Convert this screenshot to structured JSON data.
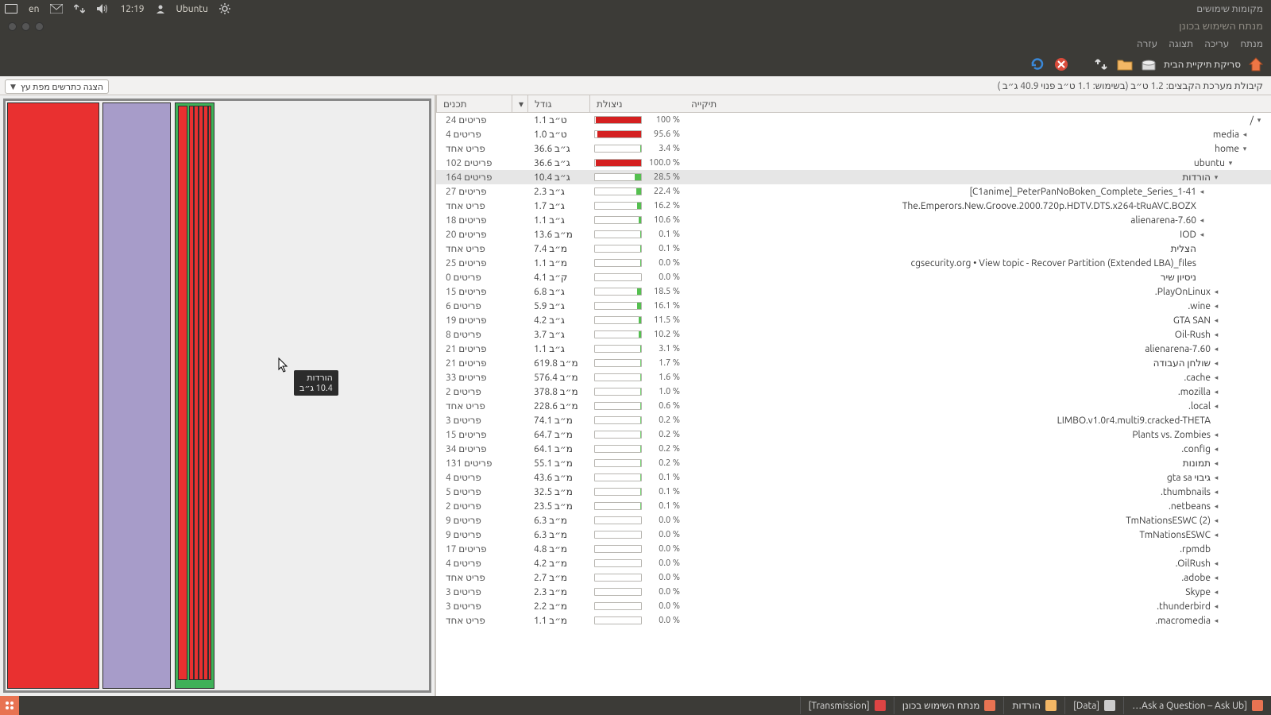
{
  "topbar": {
    "lang": "en",
    "time": "12:19",
    "user": "Ubuntu",
    "right_text": "מקומות שימושים"
  },
  "window": {
    "title": "מנתח השימוש בכונן"
  },
  "menubar": [
    "מנתח",
    "עריכה",
    "תצוגה",
    "עזרה"
  ],
  "toolbar": {
    "scan_home": "סריקת תיקיית הבית"
  },
  "usage": {
    "text": "קיבולת מערכת הקבצים: 1.2 ט״ב (בשימוש: 1.1 ט״ב פנוי 40.9 ג״ב )"
  },
  "viewbutton": "הצגה כתרשים מפת עץ",
  "headers": {
    "folder": "תיקייה",
    "util": "ניצולת",
    "size": "גודל",
    "contents": "תכנים"
  },
  "rows": [
    {
      "name": "/",
      "depth": 0,
      "exp": true,
      "arrow": true,
      "pct": "100 %",
      "bar": 99,
      "color": "#d42020",
      "size": "1.1 ט״ב",
      "contents": "24 פריטים"
    },
    {
      "name": "media",
      "depth": 1,
      "exp": false,
      "arrow": true,
      "pct": "95.6 %",
      "bar": 95,
      "color": "#d42020",
      "size": "1.0 ט״ב",
      "contents": "4 פריטים"
    },
    {
      "name": "home",
      "depth": 1,
      "exp": true,
      "arrow": true,
      "pct": "3.4 %",
      "bar": 2,
      "color": "#55c050",
      "size": "36.6 ג״ב",
      "contents": "פריט אחד"
    },
    {
      "name": "ubuntu",
      "depth": 2,
      "exp": true,
      "arrow": true,
      "pct": "100.0 %",
      "bar": 99,
      "color": "#d42020",
      "size": "36.6 ג״ב",
      "contents": "102 פריטים"
    },
    {
      "name": "הורדות",
      "depth": 3,
      "exp": true,
      "arrow": true,
      "pct": "28.5 %",
      "bar": 14,
      "color": "#55c050",
      "size": "10.4 ג״ב",
      "contents": "164 פריטים",
      "sel": true
    },
    {
      "name": "[C1anime]_PeterPanNoBoken_Complete_Series_1-41",
      "depth": 4,
      "arrow": true,
      "pct": "22.4 %",
      "bar": 11,
      "color": "#55c050",
      "size": "2.3 ג״ב",
      "contents": "27 פריטים"
    },
    {
      "name": "The.Emperors.New.Groove.2000.720p.HDTV.DTS.x264-tRuAVC.BOZX",
      "depth": 4,
      "arrow": false,
      "pct": "16.2 %",
      "bar": 8,
      "color": "#55c050",
      "size": "1.7 ג״ב",
      "contents": "פריט אחד"
    },
    {
      "name": "alienarena-7.60",
      "depth": 4,
      "arrow": true,
      "pct": "10.6 %",
      "bar": 5,
      "color": "#55c050",
      "size": "1.1 ג״ב",
      "contents": "18 פריטים"
    },
    {
      "name": "IOD",
      "depth": 4,
      "arrow": true,
      "pct": "0.1 %",
      "bar": 1,
      "color": "#55c050",
      "size": "13.6 מ״ב",
      "contents": "20 פריטים"
    },
    {
      "name": "הצלית",
      "depth": 4,
      "arrow": false,
      "pct": "0.1 %",
      "bar": 1,
      "color": "#55c050",
      "size": "7.4 מ״ב",
      "contents": "פריט אחד"
    },
    {
      "name": "cgsecurity.org • View topic - Recover Partition (Extended LBA)_files",
      "depth": 4,
      "arrow": false,
      "pct": "0.0 %",
      "bar": 1,
      "color": "#55c050",
      "size": "1.1 מ״ב",
      "contents": "25 פריטים"
    },
    {
      "name": "ניסיון שיר",
      "depth": 4,
      "arrow": false,
      "pct": "0.0 %",
      "bar": 0,
      "color": "#55c050",
      "size": "4.1 ק״ב",
      "contents": "0 פריטים"
    },
    {
      "name": ".PlayOnLinux",
      "depth": 3,
      "arrow": true,
      "pct": "18.5 %",
      "bar": 9,
      "color": "#55c050",
      "size": "6.8 ג״ב",
      "contents": "15 פריטים"
    },
    {
      "name": ".wine",
      "depth": 3,
      "arrow": true,
      "pct": "16.1 %",
      "bar": 8,
      "color": "#55c050",
      "size": "5.9 ג״ב",
      "contents": "6 פריטים"
    },
    {
      "name": "GTA SAN",
      "depth": 3,
      "arrow": true,
      "pct": "11.5 %",
      "bar": 6,
      "color": "#55c050",
      "size": "4.2 ג״ב",
      "contents": "19 פריטים"
    },
    {
      "name": "Oil-Rush",
      "depth": 3,
      "arrow": true,
      "pct": "10.2 %",
      "bar": 5,
      "color": "#55c050",
      "size": "3.7 ג״ב",
      "contents": "8 פריטים"
    },
    {
      "name": "alienarena-7.60",
      "depth": 3,
      "arrow": true,
      "pct": "3.1 %",
      "bar": 2,
      "color": "#55c050",
      "size": "1.1 ג״ב",
      "contents": "21 פריטים"
    },
    {
      "name": "שולחן העבודה",
      "depth": 3,
      "arrow": true,
      "pct": "1.7 %",
      "bar": 1,
      "color": "#6fd06a",
      "size": "619.8 מ״ב",
      "contents": "21 פריטים"
    },
    {
      "name": ".cache",
      "depth": 3,
      "arrow": true,
      "pct": "1.6 %",
      "bar": 1,
      "color": "#6fd06a",
      "size": "576.4 מ״ב",
      "contents": "33 פריטים"
    },
    {
      "name": ".mozilla",
      "depth": 3,
      "arrow": true,
      "pct": "1.0 %",
      "bar": 1,
      "color": "#6fd06a",
      "size": "378.8 מ״ב",
      "contents": "2 פריטים"
    },
    {
      "name": ".local",
      "depth": 3,
      "arrow": true,
      "pct": "0.6 %",
      "bar": 1,
      "color": "#6fd06a",
      "size": "228.6 מ״ב",
      "contents": "פריט אחד"
    },
    {
      "name": "LIMBO.v1.0r4.multi9.cracked-THETA",
      "depth": 3,
      "arrow": false,
      "pct": "0.2 %",
      "bar": 1,
      "color": "#6fd06a",
      "size": "74.1 מ״ב",
      "contents": "3 פריטים"
    },
    {
      "name": "Plants vs. Zombies",
      "depth": 3,
      "arrow": true,
      "pct": "0.2 %",
      "bar": 1,
      "color": "#6fd06a",
      "size": "64.7 מ״ב",
      "contents": "15 פריטים"
    },
    {
      "name": ".config",
      "depth": 3,
      "arrow": true,
      "pct": "0.2 %",
      "bar": 1,
      "color": "#6fd06a",
      "size": "64.1 מ״ב",
      "contents": "34 פריטים"
    },
    {
      "name": "תמונות",
      "depth": 3,
      "arrow": true,
      "pct": "0.2 %",
      "bar": 1,
      "color": "#6fd06a",
      "size": "55.1 מ״ב",
      "contents": "131 פריטים"
    },
    {
      "name": "gta sa גיבוי",
      "depth": 3,
      "arrow": true,
      "pct": "0.1 %",
      "bar": 1,
      "color": "#6fd06a",
      "size": "43.6 מ״ב",
      "contents": "4 פריטים"
    },
    {
      "name": ".thumbnails",
      "depth": 3,
      "arrow": true,
      "pct": "0.1 %",
      "bar": 1,
      "color": "#6fd06a",
      "size": "32.5 מ״ב",
      "contents": "5 פריטים"
    },
    {
      "name": ".netbeans",
      "depth": 3,
      "arrow": true,
      "pct": "0.1 %",
      "bar": 1,
      "color": "#6fd06a",
      "size": "23.5 מ״ב",
      "contents": "2 פריטים"
    },
    {
      "name": "TmNationsESWC (2)",
      "depth": 3,
      "arrow": true,
      "pct": "0.0 %",
      "bar": 0,
      "color": "#6fd06a",
      "size": "6.3 מ״ב",
      "contents": "9 פריטים"
    },
    {
      "name": "TmNationsESWC",
      "depth": 3,
      "arrow": true,
      "pct": "0.0 %",
      "bar": 0,
      "color": "#6fd06a",
      "size": "6.3 מ״ב",
      "contents": "9 פריטים"
    },
    {
      "name": ".rpmdb",
      "depth": 3,
      "arrow": false,
      "pct": "0.0 %",
      "bar": 0,
      "color": "#6fd06a",
      "size": "4.8 מ״ב",
      "contents": "17 פריטים"
    },
    {
      "name": ".OilRush",
      "depth": 3,
      "arrow": true,
      "pct": "0.0 %",
      "bar": 0,
      "color": "#6fd06a",
      "size": "4.2 מ״ב",
      "contents": "4 פריטים"
    },
    {
      "name": ".adobe",
      "depth": 3,
      "arrow": true,
      "pct": "0.0 %",
      "bar": 0,
      "color": "#6fd06a",
      "size": "2.7 מ״ב",
      "contents": "פריט אחד"
    },
    {
      "name": "Skype",
      "depth": 3,
      "arrow": true,
      "pct": "0.0 %",
      "bar": 0,
      "color": "#6fd06a",
      "size": "2.3 מ״ב",
      "contents": "3 פריטים"
    },
    {
      "name": ".thunderbird",
      "depth": 3,
      "arrow": true,
      "pct": "0.0 %",
      "bar": 0,
      "color": "#6fd06a",
      "size": "2.2 מ״ב",
      "contents": "3 פריטים"
    },
    {
      "name": ".macromedia",
      "depth": 3,
      "arrow": true,
      "pct": "0.0 %",
      "bar": 0,
      "color": "#6fd06a",
      "size": "1.1 מ״ב",
      "contents": "פריט אחד"
    }
  ],
  "tooltip": {
    "line1": "הורדות",
    "line2": "10.4 ג״ב"
  },
  "bottombar": {
    "tabs": [
      {
        "label": "[Transmission]"
      },
      {
        "label": "מנתח השימוש בכונן"
      },
      {
        "label": "הורדות"
      },
      {
        "label": "[Data]"
      },
      {
        "label": "[Ask a Question – Ask Ub…"
      }
    ]
  }
}
